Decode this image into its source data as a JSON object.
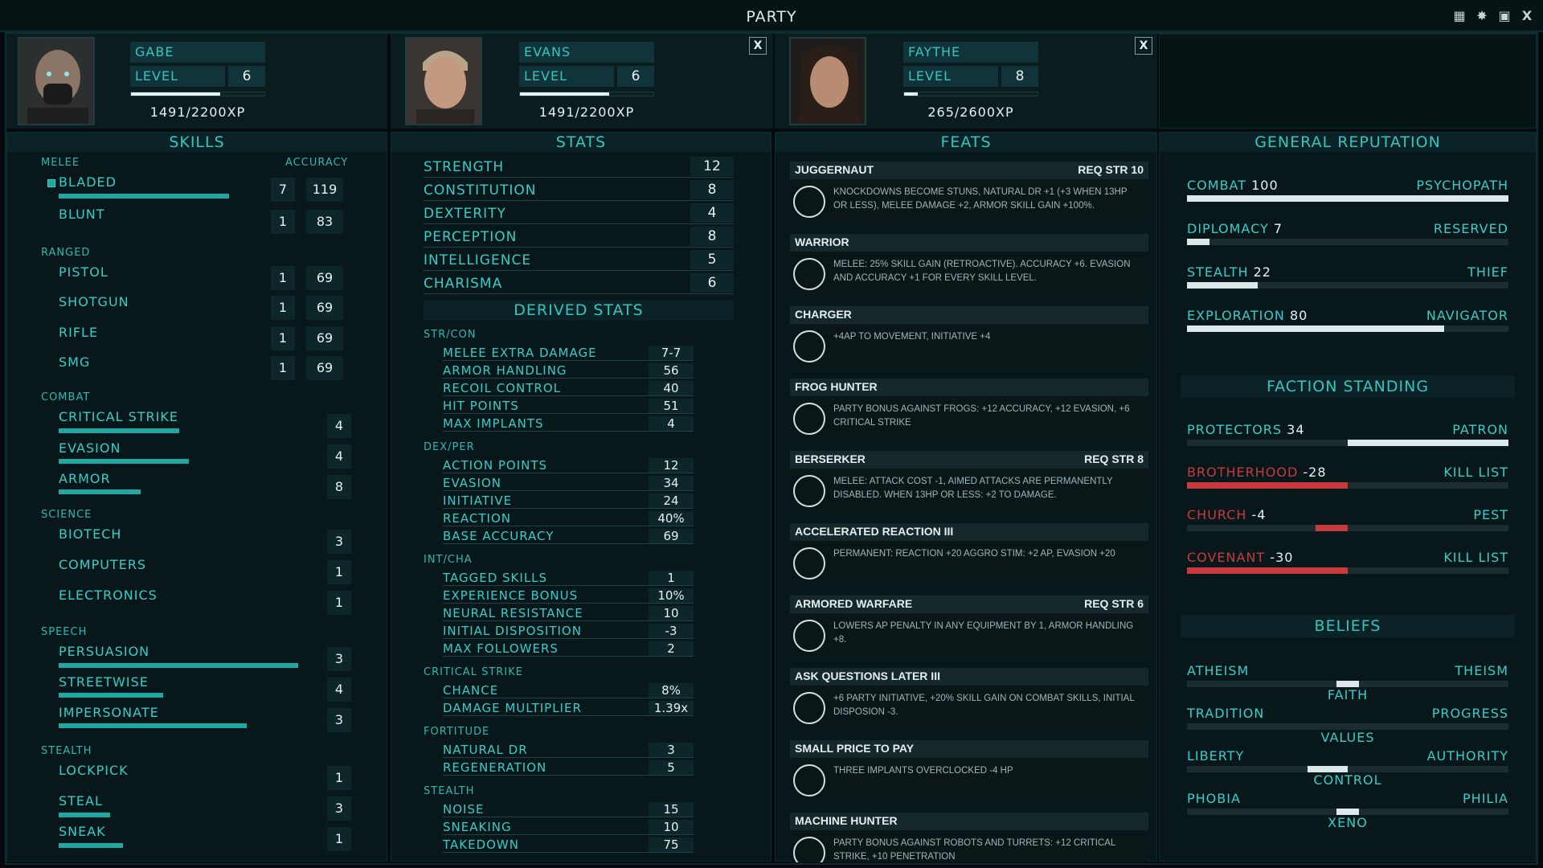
{
  "window": {
    "title": "PARTY",
    "close": "X"
  },
  "characters": [
    {
      "name": "GABE",
      "level_label": "LEVEL",
      "level": "6",
      "xp": "1491/2200XP",
      "xp_pct": 0.67
    },
    {
      "name": "EVANS",
      "level_label": "LEVEL",
      "level": "6",
      "xp": "1491/2200XP",
      "xp_pct": 0.67,
      "close": "X"
    },
    {
      "name": "FAYTHE",
      "level_label": "LEVEL",
      "level": "8",
      "xp": "265/2600XP",
      "xp_pct": 0.1,
      "close": "X"
    }
  ],
  "skills": {
    "title": "SKILLS",
    "accuracy_label": "ACCURACY",
    "categories": [
      {
        "name": "MELEE",
        "items": [
          {
            "name": "BLADED",
            "value": "7",
            "accuracy": "119",
            "fill": 0.78,
            "tagged": true
          },
          {
            "name": "BLUNT",
            "value": "1",
            "accuracy": "83",
            "fill": 0
          }
        ]
      },
      {
        "name": "RANGED",
        "items": [
          {
            "name": "PISTOL",
            "value": "1",
            "accuracy": "69",
            "fill": 0
          },
          {
            "name": "SHOTGUN",
            "value": "1",
            "accuracy": "69",
            "fill": 0
          },
          {
            "name": "RIFLE",
            "value": "1",
            "accuracy": "69",
            "fill": 0
          },
          {
            "name": "SMG",
            "value": "1",
            "accuracy": "69",
            "fill": 0
          }
        ]
      },
      {
        "name": "COMBAT",
        "items": [
          {
            "name": "CRITICAL STRIKE",
            "value": "4",
            "fill": 0.41
          },
          {
            "name": "EVASION",
            "value": "4",
            "fill": 0.45
          },
          {
            "name": "ARMOR",
            "value": "8",
            "fill": 0.29
          }
        ]
      },
      {
        "name": "SCIENCE",
        "items": [
          {
            "name": "BIOTECH",
            "value": "3",
            "fill": 0
          },
          {
            "name": "COMPUTERS",
            "value": "1",
            "fill": 0
          },
          {
            "name": "ELECTRONICS",
            "value": "1",
            "fill": 0
          }
        ]
      },
      {
        "name": "SPEECH",
        "items": [
          {
            "name": "PERSUASION",
            "value": "3",
            "fill": 0.84
          },
          {
            "name": "STREETWISE",
            "value": "4",
            "fill": 0.42
          },
          {
            "name": "IMPERSONATE",
            "value": "3",
            "fill": 0.66
          }
        ]
      },
      {
        "name": "STEALTH",
        "items": [
          {
            "name": "LOCKPICK",
            "value": "1",
            "fill": 0
          },
          {
            "name": "STEAL",
            "value": "3",
            "fill": 0.18
          },
          {
            "name": "SNEAK",
            "value": "1",
            "fill": 0.23
          }
        ]
      }
    ]
  },
  "stats": {
    "title": "STATS",
    "primary": [
      {
        "name": "STRENGTH",
        "value": "12"
      },
      {
        "name": "CONSTITUTION",
        "value": "8"
      },
      {
        "name": "DEXTERITY",
        "value": "4"
      },
      {
        "name": "PERCEPTION",
        "value": "8"
      },
      {
        "name": "INTELLIGENCE",
        "value": "5"
      },
      {
        "name": "CHARISMA",
        "value": "6"
      }
    ],
    "derived_title": "DERIVED STATS",
    "derived": [
      {
        "name": "STR/CON",
        "items": [
          {
            "name": "MELEE EXTRA DAMAGE",
            "value": "7-7"
          },
          {
            "name": "ARMOR HANDLING",
            "value": "56"
          },
          {
            "name": "RECOIL CONTROL",
            "value": "40"
          },
          {
            "name": "HIT POINTS",
            "value": "51"
          },
          {
            "name": "MAX IMPLANTS",
            "value": "4"
          }
        ]
      },
      {
        "name": "DEX/PER",
        "items": [
          {
            "name": "ACTION POINTS",
            "value": "12"
          },
          {
            "name": "EVASION",
            "value": "34"
          },
          {
            "name": "INITIATIVE",
            "value": "24"
          },
          {
            "name": "REACTION",
            "value": "40%"
          },
          {
            "name": "BASE ACCURACY",
            "value": "69"
          }
        ]
      },
      {
        "name": "INT/CHA",
        "items": [
          {
            "name": "TAGGED SKILLS",
            "value": "1"
          },
          {
            "name": "EXPERIENCE BONUS",
            "value": "10%"
          },
          {
            "name": "NEURAL RESISTANCE",
            "value": "10"
          },
          {
            "name": "INITIAL DISPOSITION",
            "value": "-3"
          },
          {
            "name": "MAX FOLLOWERS",
            "value": "2"
          }
        ]
      },
      {
        "name": "CRITICAL STRIKE",
        "items": [
          {
            "name": "CHANCE",
            "value": "8%"
          },
          {
            "name": "DAMAGE MULTIPLIER",
            "value": "1.39x"
          }
        ]
      },
      {
        "name": "FORTITUDE",
        "items": [
          {
            "name": "NATURAL DR",
            "value": "3"
          },
          {
            "name": "REGENERATION",
            "value": "5"
          }
        ]
      },
      {
        "name": "STEALTH",
        "items": [
          {
            "name": "NOISE",
            "value": "15"
          },
          {
            "name": "SNEAKING",
            "value": "10"
          },
          {
            "name": "TAKEDOWN",
            "value": "75"
          }
        ]
      }
    ]
  },
  "feats": {
    "title": "FEATS",
    "items": [
      {
        "name": "JUGGERNAUT",
        "req": "REQ STR 10",
        "icon": "juggernaut-icon",
        "desc": "KNOCKDOWNS BECOME STUNS, NATURAL DR +1 (+3 WHEN 13HP OR LESS), MELEE DAMAGE +2, ARMOR SKILL GAIN +100%."
      },
      {
        "name": "WARRIOR",
        "req": "",
        "icon": "warrior-helmet-icon",
        "desc": "MELEE: 25% SKILL GAIN (RETROACTIVE). ACCURACY +6. EVASION AND ACCURACY +1 FOR EVERY SKILL LEVEL."
      },
      {
        "name": "CHARGER",
        "req": "",
        "icon": "football-helmet-icon",
        "desc": "+4AP TO MOVEMENT, INITIATIVE +4"
      },
      {
        "name": "FROG HUNTER",
        "req": "",
        "icon": "frog-target-icon",
        "desc": "PARTY BONUS AGAINST FROGS: +12 ACCURACY, +12 EVASION, +6 CRITICAL STRIKE"
      },
      {
        "name": "BERSERKER",
        "req": "REQ STR 8",
        "icon": "skull-crossbones-icon",
        "desc": "MELEE: ATTACK COST -1, AIMED ATTACKS ARE PERMANENTLY DISABLED. WHEN 13HP OR LESS: +2 TO DAMAGE."
      },
      {
        "name": "ACCELERATED REACTION III",
        "req": "",
        "icon": "dna-icon",
        "desc": "PERMANENT: REACTION +20 AGGRO STIM: +2 AP, EVASION +20"
      },
      {
        "name": "ARMORED WARFARE",
        "req": "REQ STR 6",
        "icon": "armor-vest-icon",
        "desc": "LOWERS AP PENALTY IN ANY EQUIPMENT BY 1, ARMOR HANDLING +8."
      },
      {
        "name": "ASK QUESTIONS LATER III",
        "req": "",
        "icon": "gun-icon",
        "desc": "+6 PARTY INITIATIVE, +20% SKILL GAIN ON COMBAT SKILLS, INITIAL DISPOSION -3."
      },
      {
        "name": "SMALL PRICE TO PAY",
        "req": "",
        "icon": "gauge-icon",
        "desc": "THREE IMPLANTS OVERCLOCKED -4 HP"
      },
      {
        "name": "MACHINE HUNTER",
        "req": "",
        "icon": "robot-icon",
        "desc": "PARTY BONUS AGAINST ROBOTS AND TURRETS: +12 CRITICAL STRIKE, +10 PENETRATION"
      }
    ]
  },
  "reputation": {
    "title": "GENERAL REPUTATION",
    "items": [
      {
        "name": "COMBAT",
        "value": "100",
        "rank": "PSYCHOPATH",
        "fill": 1.0
      },
      {
        "name": "DIPLOMACY",
        "value": "7",
        "rank": "RESERVED",
        "fill": 0.07
      },
      {
        "name": "STEALTH",
        "value": "22",
        "rank": "THIEF",
        "fill": 0.22
      },
      {
        "name": "EXPLORATION",
        "value": "80",
        "rank": "NAVIGATOR",
        "fill": 0.8
      }
    ],
    "faction_title": "FACTION STANDING",
    "factions": [
      {
        "name": "PROTECTORS",
        "value": "34",
        "rank": "PATRON",
        "score": 34
      },
      {
        "name": "BROTHERHOOD",
        "value": "-28",
        "rank": "KILL LIST",
        "score": -28
      },
      {
        "name": "CHURCH",
        "value": "-4",
        "rank": "PEST",
        "score": -4
      },
      {
        "name": "COVENANT",
        "value": "-30",
        "rank": "KILL LIST",
        "score": -30
      }
    ],
    "beliefs_title": "BELIEFS",
    "beliefs": [
      {
        "left": "ATHEISM",
        "right": "THEISM",
        "center": "FAITH",
        "pos": 0.5
      },
      {
        "left": "TRADITION",
        "right": "PROGRESS",
        "center": "VALUES",
        "pos": 0.5
      },
      {
        "left": "LIBERTY",
        "right": "AUTHORITY",
        "center": "CONTROL",
        "pos": 0.44
      },
      {
        "left": "PHOBIA",
        "right": "PHILIA",
        "center": "XENO",
        "pos": 0.5
      }
    ]
  },
  "colors": {
    "accent": "#39d4cf",
    "negative": "#c93a3e",
    "bar_light": "#dce8e9"
  }
}
